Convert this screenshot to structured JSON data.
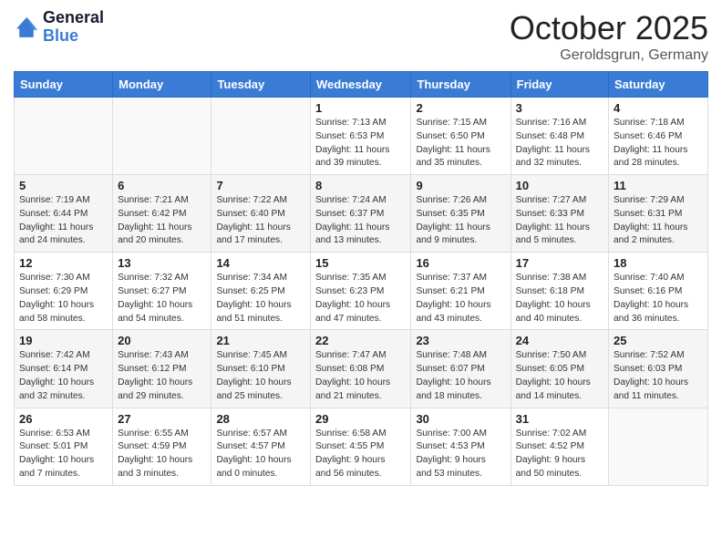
{
  "header": {
    "logo_line1": "General",
    "logo_line2": "Blue",
    "month": "October 2025",
    "location": "Geroldsgrun, Germany"
  },
  "weekdays": [
    "Sunday",
    "Monday",
    "Tuesday",
    "Wednesday",
    "Thursday",
    "Friday",
    "Saturday"
  ],
  "weeks": [
    [
      {
        "day": "",
        "info": ""
      },
      {
        "day": "",
        "info": ""
      },
      {
        "day": "",
        "info": ""
      },
      {
        "day": "1",
        "info": "Sunrise: 7:13 AM\nSunset: 6:53 PM\nDaylight: 11 hours\nand 39 minutes."
      },
      {
        "day": "2",
        "info": "Sunrise: 7:15 AM\nSunset: 6:50 PM\nDaylight: 11 hours\nand 35 minutes."
      },
      {
        "day": "3",
        "info": "Sunrise: 7:16 AM\nSunset: 6:48 PM\nDaylight: 11 hours\nand 32 minutes."
      },
      {
        "day": "4",
        "info": "Sunrise: 7:18 AM\nSunset: 6:46 PM\nDaylight: 11 hours\nand 28 minutes."
      }
    ],
    [
      {
        "day": "5",
        "info": "Sunrise: 7:19 AM\nSunset: 6:44 PM\nDaylight: 11 hours\nand 24 minutes."
      },
      {
        "day": "6",
        "info": "Sunrise: 7:21 AM\nSunset: 6:42 PM\nDaylight: 11 hours\nand 20 minutes."
      },
      {
        "day": "7",
        "info": "Sunrise: 7:22 AM\nSunset: 6:40 PM\nDaylight: 11 hours\nand 17 minutes."
      },
      {
        "day": "8",
        "info": "Sunrise: 7:24 AM\nSunset: 6:37 PM\nDaylight: 11 hours\nand 13 minutes."
      },
      {
        "day": "9",
        "info": "Sunrise: 7:26 AM\nSunset: 6:35 PM\nDaylight: 11 hours\nand 9 minutes."
      },
      {
        "day": "10",
        "info": "Sunrise: 7:27 AM\nSunset: 6:33 PM\nDaylight: 11 hours\nand 5 minutes."
      },
      {
        "day": "11",
        "info": "Sunrise: 7:29 AM\nSunset: 6:31 PM\nDaylight: 11 hours\nand 2 minutes."
      }
    ],
    [
      {
        "day": "12",
        "info": "Sunrise: 7:30 AM\nSunset: 6:29 PM\nDaylight: 10 hours\nand 58 minutes."
      },
      {
        "day": "13",
        "info": "Sunrise: 7:32 AM\nSunset: 6:27 PM\nDaylight: 10 hours\nand 54 minutes."
      },
      {
        "day": "14",
        "info": "Sunrise: 7:34 AM\nSunset: 6:25 PM\nDaylight: 10 hours\nand 51 minutes."
      },
      {
        "day": "15",
        "info": "Sunrise: 7:35 AM\nSunset: 6:23 PM\nDaylight: 10 hours\nand 47 minutes."
      },
      {
        "day": "16",
        "info": "Sunrise: 7:37 AM\nSunset: 6:21 PM\nDaylight: 10 hours\nand 43 minutes."
      },
      {
        "day": "17",
        "info": "Sunrise: 7:38 AM\nSunset: 6:18 PM\nDaylight: 10 hours\nand 40 minutes."
      },
      {
        "day": "18",
        "info": "Sunrise: 7:40 AM\nSunset: 6:16 PM\nDaylight: 10 hours\nand 36 minutes."
      }
    ],
    [
      {
        "day": "19",
        "info": "Sunrise: 7:42 AM\nSunset: 6:14 PM\nDaylight: 10 hours\nand 32 minutes."
      },
      {
        "day": "20",
        "info": "Sunrise: 7:43 AM\nSunset: 6:12 PM\nDaylight: 10 hours\nand 29 minutes."
      },
      {
        "day": "21",
        "info": "Sunrise: 7:45 AM\nSunset: 6:10 PM\nDaylight: 10 hours\nand 25 minutes."
      },
      {
        "day": "22",
        "info": "Sunrise: 7:47 AM\nSunset: 6:08 PM\nDaylight: 10 hours\nand 21 minutes."
      },
      {
        "day": "23",
        "info": "Sunrise: 7:48 AM\nSunset: 6:07 PM\nDaylight: 10 hours\nand 18 minutes."
      },
      {
        "day": "24",
        "info": "Sunrise: 7:50 AM\nSunset: 6:05 PM\nDaylight: 10 hours\nand 14 minutes."
      },
      {
        "day": "25",
        "info": "Sunrise: 7:52 AM\nSunset: 6:03 PM\nDaylight: 10 hours\nand 11 minutes."
      }
    ],
    [
      {
        "day": "26",
        "info": "Sunrise: 6:53 AM\nSunset: 5:01 PM\nDaylight: 10 hours\nand 7 minutes."
      },
      {
        "day": "27",
        "info": "Sunrise: 6:55 AM\nSunset: 4:59 PM\nDaylight: 10 hours\nand 3 minutes."
      },
      {
        "day": "28",
        "info": "Sunrise: 6:57 AM\nSunset: 4:57 PM\nDaylight: 10 hours\nand 0 minutes."
      },
      {
        "day": "29",
        "info": "Sunrise: 6:58 AM\nSunset: 4:55 PM\nDaylight: 9 hours\nand 56 minutes."
      },
      {
        "day": "30",
        "info": "Sunrise: 7:00 AM\nSunset: 4:53 PM\nDaylight: 9 hours\nand 53 minutes."
      },
      {
        "day": "31",
        "info": "Sunrise: 7:02 AM\nSunset: 4:52 PM\nDaylight: 9 hours\nand 50 minutes."
      },
      {
        "day": "",
        "info": ""
      }
    ]
  ]
}
